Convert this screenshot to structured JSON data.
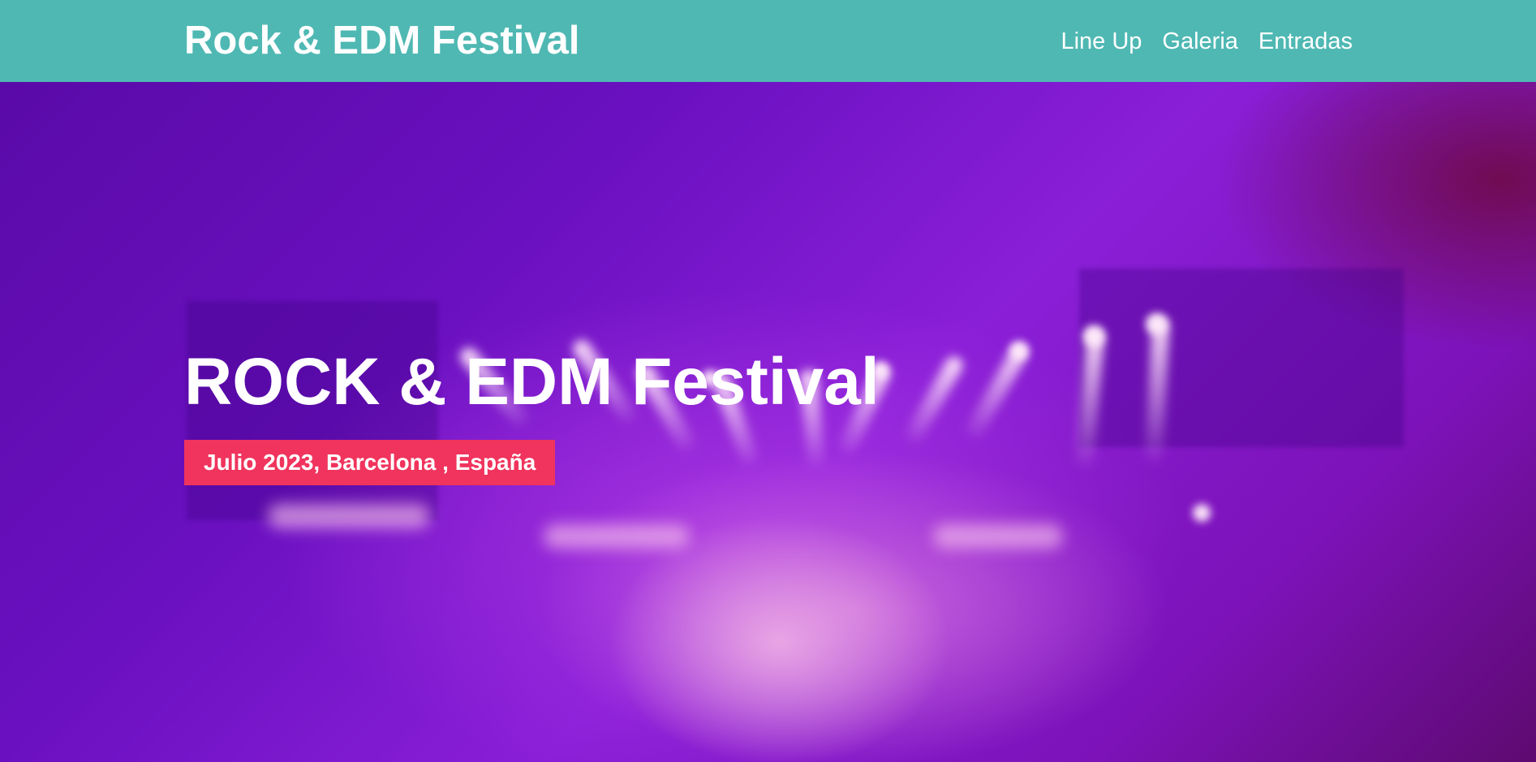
{
  "header": {
    "logo": "Rock & EDM Festival",
    "nav": [
      {
        "label": "Line Up"
      },
      {
        "label": "Galeria"
      },
      {
        "label": "Entradas"
      }
    ]
  },
  "hero": {
    "title": "ROCK & EDM Festival",
    "subtitle": "Julio 2023, Barcelona , España",
    "background_image": "concert-stage-lights"
  },
  "colors": {
    "header_bg": "#4fb8b3",
    "badge_bg": "#f0345d",
    "hero_tint": "#7a18d0",
    "text": "#ffffff"
  }
}
